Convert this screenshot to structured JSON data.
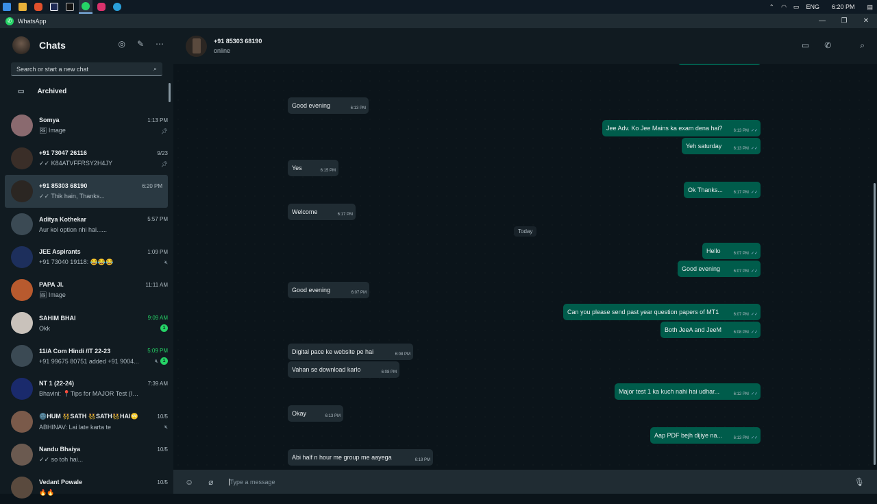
{
  "app": {
    "title": "WhatsApp"
  },
  "taskbar": {
    "lang": "ENG",
    "time": "6:20 PM"
  },
  "sidebar": {
    "title": "Chats",
    "search_placeholder": "Search or start a new chat",
    "archived": "Archived",
    "chats": [
      {
        "name": "Somya",
        "time": "1:13 PM",
        "msg": "🖼 Image",
        "pinned": true,
        "avatar_color": "#8a6a6f"
      },
      {
        "name": "+91 73047 26116",
        "time": "9/23",
        "msg": "✓✓ K84ATVFFRSY2H4JY",
        "pinned": true,
        "avatar_color": "#3a2e28"
      },
      {
        "name": "+91 85303 68190",
        "time": "6:20 PM",
        "msg": "✓✓ Thik hain, Thanks...",
        "selected": true,
        "avatar_color": "#2b2622"
      },
      {
        "name": "Aditya Kothekar",
        "time": "5:57 PM",
        "msg": "Aur koi option nhi hai......",
        "avatar_color": "#3b4a54"
      },
      {
        "name": "JEE Aspirants",
        "time": "1:09 PM",
        "msg": "+91 73040 19118: 😂😂😂",
        "muted": true,
        "avatar_color": "#1d2f5c"
      },
      {
        "name": "PAPA JI.",
        "time": "11:11 AM",
        "msg": "🖼 Image",
        "avatar_color": "#b85a2e"
      },
      {
        "name": "SAHIM BHAI",
        "time": "9:09 AM",
        "msg": "Okk",
        "time_green": true,
        "unread": "1",
        "avatar_color": "#c9c2bb"
      },
      {
        "name": "11/A Com Hindi /IT 22-23",
        "time": "5:09 PM",
        "msg": "+91 99675 80751 added +91 9004...",
        "time_green": true,
        "muted": true,
        "unread": "1",
        "avatar_color": "#3b4a54"
      },
      {
        "name": "NT 1 (22-24)",
        "time": "7:39 AM",
        "msg": "Bhavini: 📍Tips for MAJOR Test (In Ge...",
        "avatar_color": "#1a2a6c"
      },
      {
        "name": "🌚HUM 👯SATH 👯SATH👯HAI🙄",
        "time": "10/5",
        "msg": "ABHINAV: Lai late karta te",
        "muted": true,
        "avatar_color": "#7a5a4a"
      },
      {
        "name": "Nandu Bhaiya",
        "time": "10/5",
        "msg": "✓✓ so toh hai...",
        "avatar_color": "#6b5a50"
      },
      {
        "name": "Vedant Powale",
        "time": "10/5",
        "msg": "🔥🔥",
        "avatar_color": "#5a4a3e"
      }
    ]
  },
  "conversation": {
    "name": "+91 85303 68190",
    "status": "online",
    "day_label": "Today",
    "compose_placeholder": "Type a message",
    "messages": [
      {
        "dir": "in",
        "text": "Good evening",
        "time": "6:13 PM"
      },
      {
        "dir": "out",
        "text": "Jee Adv. Ko Jee Mains ka exam dena hai?",
        "time": "6:13 PM"
      },
      {
        "dir": "out",
        "text": "Yeh saturday",
        "time": "6:13 PM"
      },
      {
        "dir": "in",
        "text": "Yes",
        "time": "6:15 PM"
      },
      {
        "dir": "out",
        "text": "Ok Thanks...",
        "time": "6:17 PM"
      },
      {
        "dir": "in",
        "text": "Welcome",
        "time": "6:17 PM"
      },
      {
        "dir": "out",
        "text": "Hello",
        "time": "6:07 PM"
      },
      {
        "dir": "out",
        "text": "Good evening",
        "time": "6:07 PM"
      },
      {
        "dir": "in",
        "text": "Good evening",
        "time": "6:07 PM"
      },
      {
        "dir": "out",
        "text": "Can you please send past year question papers of MT1",
        "time": "6:07 PM"
      },
      {
        "dir": "out",
        "text": "Both JeeA and JeeM",
        "time": "6:08 PM"
      },
      {
        "dir": "in",
        "text": "Digital pace ke website pe hai",
        "time": "6:08 PM"
      },
      {
        "dir": "in",
        "text": "Vahan se download karlo",
        "time": "6:08 PM"
      },
      {
        "dir": "out",
        "text": "Major test 1 ka kuch nahi hai udhar...",
        "time": "6:12 PM"
      },
      {
        "dir": "in",
        "text": "Okay",
        "time": "6:13 PM"
      },
      {
        "dir": "out",
        "text": "Aap PDF bejh dijiye na...",
        "time": "6:13 PM"
      },
      {
        "dir": "in",
        "text": "Abi half n hour me group me aayega",
        "time": "6:18 PM"
      },
      {
        "dir": "out",
        "text": "Thik hain, Thanks...",
        "time": "6:20 PM"
      }
    ]
  },
  "colors": {
    "accent": "#25d366",
    "outgoing": "#005c4b",
    "incoming": "#202c33"
  }
}
